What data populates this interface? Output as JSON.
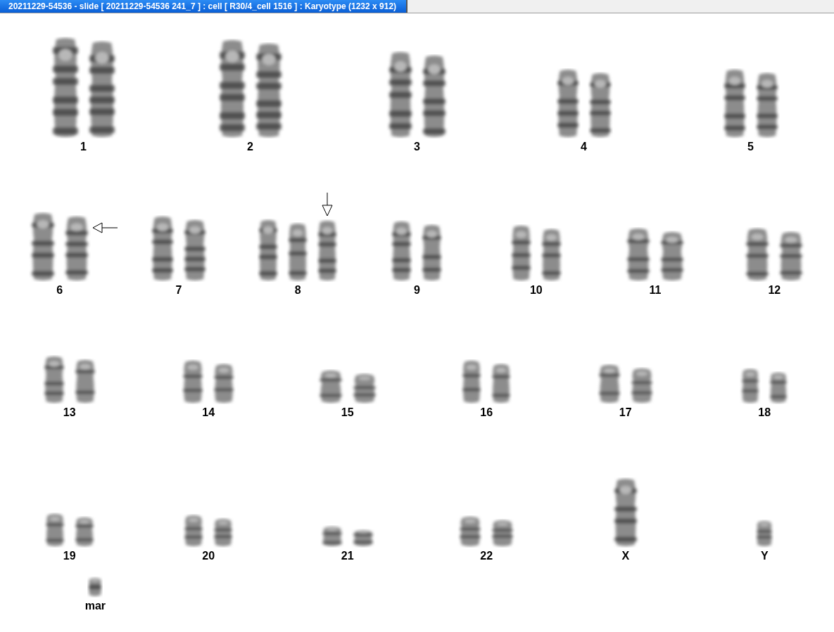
{
  "window": {
    "title": "20211229-54536 - slide [ 20211229-54536 241_7 ] : cell [ R30/4_cell 1516 ] : Karyotype  (1232 x 912)"
  },
  "rows": [
    {
      "groups": [
        {
          "label": "1",
          "chromosomes": [
            {
              "kind": "plain"
            },
            {
              "kind": "plain"
            }
          ]
        },
        {
          "label": "2",
          "chromosomes": [
            {
              "kind": "plain"
            },
            {
              "kind": "plain"
            }
          ]
        },
        {
          "label": "3",
          "chromosomes": [
            {
              "kind": "plain"
            },
            {
              "kind": "plain"
            }
          ]
        },
        {
          "label": "4",
          "chromosomes": [
            {
              "kind": "plain"
            },
            {
              "kind": "plain"
            }
          ]
        },
        {
          "label": "5",
          "chromosomes": [
            {
              "kind": "plain"
            },
            {
              "kind": "plain"
            }
          ]
        }
      ]
    },
    {
      "groups": [
        {
          "label": "6",
          "chromosomes": [
            {
              "kind": "plain"
            },
            {
              "kind": "marked-left"
            }
          ]
        },
        {
          "label": "7",
          "chromosomes": [
            {
              "kind": "plain"
            },
            {
              "kind": "plain"
            }
          ]
        },
        {
          "label": "8",
          "chromosomes": [
            {
              "kind": "plain"
            },
            {
              "kind": "plain"
            },
            {
              "kind": "marked-down"
            }
          ]
        },
        {
          "label": "9",
          "chromosomes": [
            {
              "kind": "plain"
            },
            {
              "kind": "plain"
            }
          ]
        },
        {
          "label": "10",
          "chromosomes": [
            {
              "kind": "plain"
            },
            {
              "kind": "plain"
            }
          ]
        },
        {
          "label": "11",
          "chromosomes": [
            {
              "kind": "plain"
            },
            {
              "kind": "plain"
            }
          ]
        },
        {
          "label": "12",
          "chromosomes": [
            {
              "kind": "plain"
            },
            {
              "kind": "plain"
            }
          ]
        }
      ]
    },
    {
      "groups": [
        {
          "label": "13",
          "chromosomes": [
            {
              "kind": "plain"
            },
            {
              "kind": "plain"
            }
          ]
        },
        {
          "label": "14",
          "chromosomes": [
            {
              "kind": "plain"
            },
            {
              "kind": "plain"
            }
          ]
        },
        {
          "label": "15",
          "chromosomes": [
            {
              "kind": "plain"
            },
            {
              "kind": "plain"
            }
          ]
        },
        {
          "label": "16",
          "chromosomes": [
            {
              "kind": "plain"
            },
            {
              "kind": "plain"
            }
          ]
        },
        {
          "label": "17",
          "chromosomes": [
            {
              "kind": "plain"
            },
            {
              "kind": "plain"
            }
          ]
        },
        {
          "label": "18",
          "chromosomes": [
            {
              "kind": "plain"
            },
            {
              "kind": "plain"
            }
          ]
        }
      ]
    },
    {
      "groups": [
        {
          "label": "19",
          "chromosomes": [
            {
              "kind": "plain"
            },
            {
              "kind": "plain"
            }
          ]
        },
        {
          "label": "20",
          "chromosomes": [
            {
              "kind": "plain"
            },
            {
              "kind": "plain"
            }
          ]
        },
        {
          "label": "21",
          "chromosomes": [
            {
              "kind": "plain"
            },
            {
              "kind": "plain"
            }
          ]
        },
        {
          "label": "22",
          "chromosomes": [
            {
              "kind": "plain"
            },
            {
              "kind": "plain"
            }
          ]
        },
        {
          "label": "X",
          "chromosomes": [
            {
              "kind": "plain"
            }
          ]
        },
        {
          "label": "Y",
          "chromosomes": [
            {
              "kind": "plain"
            }
          ]
        }
      ]
    },
    {
      "groups": [
        {
          "label": "mar",
          "chromosomes": [
            {
              "kind": "plain"
            }
          ]
        }
      ]
    }
  ]
}
